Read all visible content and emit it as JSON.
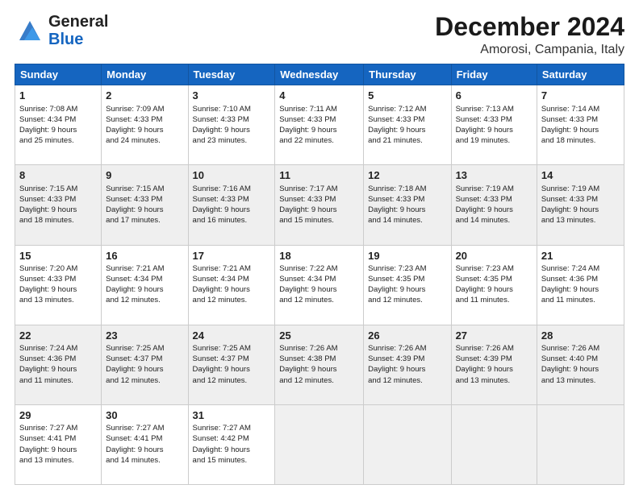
{
  "logo": {
    "general": "General",
    "blue": "Blue"
  },
  "title": "December 2024",
  "location": "Amorosi, Campania, Italy",
  "weekdays": [
    "Sunday",
    "Monday",
    "Tuesday",
    "Wednesday",
    "Thursday",
    "Friday",
    "Saturday"
  ],
  "weeks": [
    [
      {
        "day": "1",
        "info": "Sunrise: 7:08 AM\nSunset: 4:34 PM\nDaylight: 9 hours\nand 25 minutes."
      },
      {
        "day": "2",
        "info": "Sunrise: 7:09 AM\nSunset: 4:33 PM\nDaylight: 9 hours\nand 24 minutes."
      },
      {
        "day": "3",
        "info": "Sunrise: 7:10 AM\nSunset: 4:33 PM\nDaylight: 9 hours\nand 23 minutes."
      },
      {
        "day": "4",
        "info": "Sunrise: 7:11 AM\nSunset: 4:33 PM\nDaylight: 9 hours\nand 22 minutes."
      },
      {
        "day": "5",
        "info": "Sunrise: 7:12 AM\nSunset: 4:33 PM\nDaylight: 9 hours\nand 21 minutes."
      },
      {
        "day": "6",
        "info": "Sunrise: 7:13 AM\nSunset: 4:33 PM\nDaylight: 9 hours\nand 19 minutes."
      },
      {
        "day": "7",
        "info": "Sunrise: 7:14 AM\nSunset: 4:33 PM\nDaylight: 9 hours\nand 18 minutes."
      }
    ],
    [
      {
        "day": "8",
        "info": "Sunrise: 7:15 AM\nSunset: 4:33 PM\nDaylight: 9 hours\nand 18 minutes."
      },
      {
        "day": "9",
        "info": "Sunrise: 7:15 AM\nSunset: 4:33 PM\nDaylight: 9 hours\nand 17 minutes."
      },
      {
        "day": "10",
        "info": "Sunrise: 7:16 AM\nSunset: 4:33 PM\nDaylight: 9 hours\nand 16 minutes."
      },
      {
        "day": "11",
        "info": "Sunrise: 7:17 AM\nSunset: 4:33 PM\nDaylight: 9 hours\nand 15 minutes."
      },
      {
        "day": "12",
        "info": "Sunrise: 7:18 AM\nSunset: 4:33 PM\nDaylight: 9 hours\nand 14 minutes."
      },
      {
        "day": "13",
        "info": "Sunrise: 7:19 AM\nSunset: 4:33 PM\nDaylight: 9 hours\nand 14 minutes."
      },
      {
        "day": "14",
        "info": "Sunrise: 7:19 AM\nSunset: 4:33 PM\nDaylight: 9 hours\nand 13 minutes."
      }
    ],
    [
      {
        "day": "15",
        "info": "Sunrise: 7:20 AM\nSunset: 4:33 PM\nDaylight: 9 hours\nand 13 minutes."
      },
      {
        "day": "16",
        "info": "Sunrise: 7:21 AM\nSunset: 4:34 PM\nDaylight: 9 hours\nand 12 minutes."
      },
      {
        "day": "17",
        "info": "Sunrise: 7:21 AM\nSunset: 4:34 PM\nDaylight: 9 hours\nand 12 minutes."
      },
      {
        "day": "18",
        "info": "Sunrise: 7:22 AM\nSunset: 4:34 PM\nDaylight: 9 hours\nand 12 minutes."
      },
      {
        "day": "19",
        "info": "Sunrise: 7:23 AM\nSunset: 4:35 PM\nDaylight: 9 hours\nand 12 minutes."
      },
      {
        "day": "20",
        "info": "Sunrise: 7:23 AM\nSunset: 4:35 PM\nDaylight: 9 hours\nand 11 minutes."
      },
      {
        "day": "21",
        "info": "Sunrise: 7:24 AM\nSunset: 4:36 PM\nDaylight: 9 hours\nand 11 minutes."
      }
    ],
    [
      {
        "day": "22",
        "info": "Sunrise: 7:24 AM\nSunset: 4:36 PM\nDaylight: 9 hours\nand 11 minutes."
      },
      {
        "day": "23",
        "info": "Sunrise: 7:25 AM\nSunset: 4:37 PM\nDaylight: 9 hours\nand 12 minutes."
      },
      {
        "day": "24",
        "info": "Sunrise: 7:25 AM\nSunset: 4:37 PM\nDaylight: 9 hours\nand 12 minutes."
      },
      {
        "day": "25",
        "info": "Sunrise: 7:26 AM\nSunset: 4:38 PM\nDaylight: 9 hours\nand 12 minutes."
      },
      {
        "day": "26",
        "info": "Sunrise: 7:26 AM\nSunset: 4:39 PM\nDaylight: 9 hours\nand 12 minutes."
      },
      {
        "day": "27",
        "info": "Sunrise: 7:26 AM\nSunset: 4:39 PM\nDaylight: 9 hours\nand 13 minutes."
      },
      {
        "day": "28",
        "info": "Sunrise: 7:26 AM\nSunset: 4:40 PM\nDaylight: 9 hours\nand 13 minutes."
      }
    ],
    [
      {
        "day": "29",
        "info": "Sunrise: 7:27 AM\nSunset: 4:41 PM\nDaylight: 9 hours\nand 13 minutes."
      },
      {
        "day": "30",
        "info": "Sunrise: 7:27 AM\nSunset: 4:41 PM\nDaylight: 9 hours\nand 14 minutes."
      },
      {
        "day": "31",
        "info": "Sunrise: 7:27 AM\nSunset: 4:42 PM\nDaylight: 9 hours\nand 15 minutes."
      },
      null,
      null,
      null,
      null
    ]
  ]
}
